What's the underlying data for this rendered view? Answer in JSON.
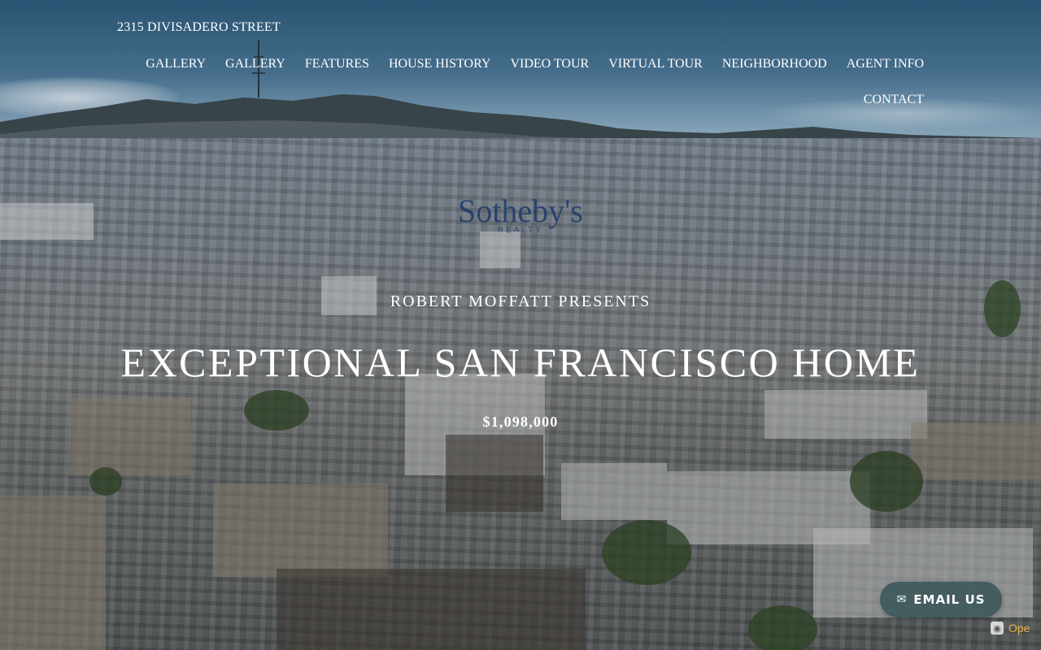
{
  "header": {
    "site_title": "2315 DIVISADERO STREET",
    "nav": [
      {
        "label": "GALLERY"
      },
      {
        "label": "GALLERY"
      },
      {
        "label": "FEATURES"
      },
      {
        "label": "HOUSE HISTORY"
      },
      {
        "label": "VIDEO TOUR"
      },
      {
        "label": "VIRTUAL TOUR"
      },
      {
        "label": "NEIGHBORHOOD"
      },
      {
        "label": "AGENT INFO"
      },
      {
        "label": "CONTACT"
      }
    ]
  },
  "logo": {
    "word": "Sotheby's",
    "sub": "REALTY"
  },
  "hero": {
    "presents": "ROBERT MOFFATT PRESENTS",
    "headline": "EXCEPTIONAL SAN FRANCISCO HOME",
    "price": "$1,098,000"
  },
  "email_button": {
    "icon": "envelope-icon",
    "label": "EMAIL US"
  },
  "badge": {
    "icon": "camera-icon",
    "label": "Ope"
  },
  "colors": {
    "text": "#ffffff",
    "logo": "#1d3a6a",
    "email_button_bg": "#345254"
  }
}
